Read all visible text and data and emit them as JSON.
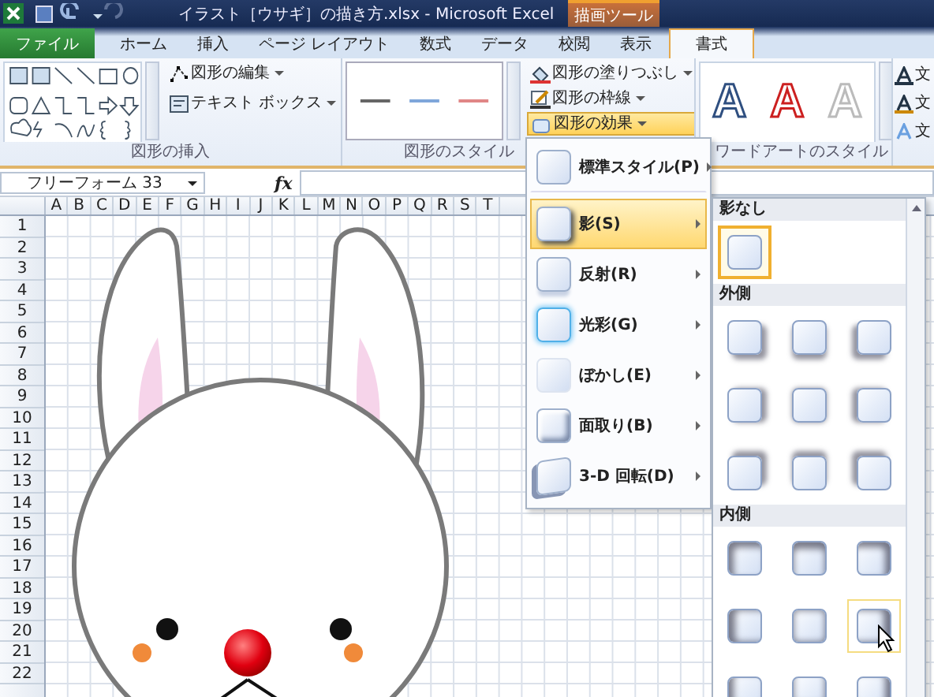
{
  "title_bar": {
    "title": "イラスト［ウサギ］の描き方.xlsx - Microsoft Excel",
    "context_label": "描画ツール"
  },
  "tabs": [
    {
      "label": "ファイル",
      "kind": "file",
      "selected": false
    },
    {
      "label": "ホーム",
      "kind": "tab",
      "selected": false
    },
    {
      "label": "挿入",
      "kind": "tab",
      "selected": false
    },
    {
      "label": "ページ レイアウト",
      "kind": "tab",
      "selected": false
    },
    {
      "label": "数式",
      "kind": "tab",
      "selected": false
    },
    {
      "label": "データ",
      "kind": "tab",
      "selected": false
    },
    {
      "label": "校閲",
      "kind": "tab",
      "selected": false
    },
    {
      "label": "表示",
      "kind": "tab",
      "selected": false
    },
    {
      "label": "書式",
      "kind": "tab",
      "selected": true
    }
  ],
  "ribbon": {
    "insert_group": {
      "label": "図形の挿入",
      "commands": [
        {
          "label": "図形の編集",
          "active": false
        },
        {
          "label": "テキスト ボックス",
          "active": false
        }
      ]
    },
    "style_group": {
      "label": "図形のスタイル",
      "commands": [
        {
          "label": "図形の塗りつぶし",
          "active": false
        },
        {
          "label": "図形の枠線",
          "active": false
        },
        {
          "label": "図形の効果",
          "active": true
        }
      ]
    },
    "wordart_group": {
      "label": "ワードアートのスタイル",
      "samples": [
        "A",
        "A",
        "A"
      ]
    },
    "text_commands": [
      "文",
      "文",
      "文"
    ]
  },
  "formula_bar": {
    "name_box": "フリーフォーム 33",
    "fx": "fx"
  },
  "sheet": {
    "columns": [
      "A",
      "B",
      "C",
      "D",
      "E",
      "F",
      "G",
      "H",
      "I",
      "J",
      "K",
      "L",
      "M",
      "N",
      "O",
      "P",
      "Q",
      "R",
      "S",
      "T"
    ],
    "rows": [
      "1",
      "2",
      "3",
      "4",
      "5",
      "6",
      "7",
      "8",
      "9",
      "10",
      "11",
      "12",
      "13",
      "14",
      "15",
      "16",
      "17",
      "18",
      "19",
      "20",
      "21",
      "22"
    ]
  },
  "effects_menu": {
    "items": [
      {
        "label": "標準スタイル(P)",
        "selected": false
      },
      {
        "label": "影(S)",
        "selected": true
      },
      {
        "label": "反射(R)",
        "selected": false
      },
      {
        "label": "光彩(G)",
        "selected": false
      },
      {
        "label": "ぼかし(E)",
        "selected": false
      },
      {
        "label": "面取り(B)",
        "selected": false
      },
      {
        "label": "3-D 回転(D)",
        "selected": false
      }
    ]
  },
  "shadow_gallery": {
    "sections": [
      {
        "title": "影なし",
        "items": [
          {
            "selected": true,
            "hovered": false
          }
        ]
      },
      {
        "title": "外側",
        "items": [
          {
            "selected": false,
            "hovered": false
          },
          {
            "selected": false,
            "hovered": false
          },
          {
            "selected": false,
            "hovered": false
          },
          {
            "selected": false,
            "hovered": false
          },
          {
            "selected": false,
            "hovered": false
          },
          {
            "selected": false,
            "hovered": false
          },
          {
            "selected": false,
            "hovered": false
          },
          {
            "selected": false,
            "hovered": false
          },
          {
            "selected": false,
            "hovered": false
          }
        ]
      },
      {
        "title": "内側",
        "items": [
          {
            "selected": false,
            "hovered": false
          },
          {
            "selected": false,
            "hovered": false
          },
          {
            "selected": false,
            "hovered": false
          },
          {
            "selected": false,
            "hovered": false
          },
          {
            "selected": false,
            "hovered": false
          },
          {
            "selected": false,
            "hovered": true
          },
          {
            "selected": false,
            "hovered": false
          },
          {
            "selected": false,
            "hovered": false
          },
          {
            "selected": false,
            "hovered": false
          }
        ]
      }
    ]
  }
}
